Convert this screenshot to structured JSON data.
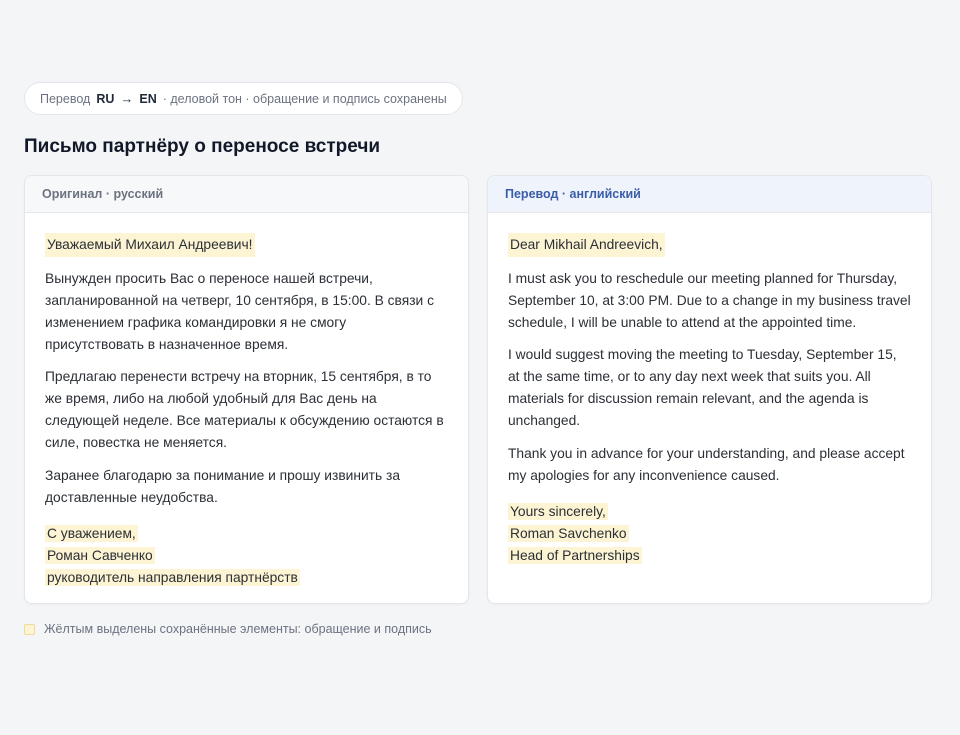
{
  "header": {
    "prefix": "Перевод",
    "source_lang": "RU",
    "arrow": "→",
    "target_lang": "EN",
    "details": "· деловой тон · обращение и подпись сохранены"
  },
  "title": "Письмо партнёру о переносе встречи",
  "original": {
    "label": "Оригинал · русский",
    "greeting": "Уважаемый Михаил Андреевич!",
    "paragraphs": [
      "Вынужден просить Вас о переносе нашей встречи, запланированной на четверг, 10 сентября, в 15:00. В связи с изменением графика командировки я не смогу присутствовать в назначенное время.",
      "Предлагаю перенести встречу на вторник, 15 сентября, в то же время, либо на любой удобный для Вас день на следующей неделе. Все материалы к обсуждению остаются в силе, повестка не меняется.",
      "Заранее благодарю за понимание и прошу извинить за доставленные неудобства."
    ],
    "signature": [
      "С уважением,",
      "Роман Савченко",
      "руководитель направления партнёрств"
    ]
  },
  "translation": {
    "label": "Перевод · английский",
    "greeting": "Dear Mikhail Andreevich,",
    "paragraphs": [
      "I must ask you to reschedule our meeting planned for Thursday, September 10, at 3:00 PM. Due to a change in my business travel schedule, I will be unable to attend at the appointed time.",
      "I would suggest moving the meeting to Tuesday, September 15, at the same time, or to any day next week that suits you. All materials for discussion remain relevant, and the agenda is unchanged.",
      "Thank you in advance for your understanding, and please accept my apologies for any inconvenience caused."
    ],
    "signature": [
      "Yours sincerely,",
      "Roman Savchenko",
      "Head of Partnerships"
    ]
  },
  "legend": {
    "text": "Жёлтым выделены сохранённые элементы: обращение и подпись",
    "color": "#fdf4d3"
  }
}
